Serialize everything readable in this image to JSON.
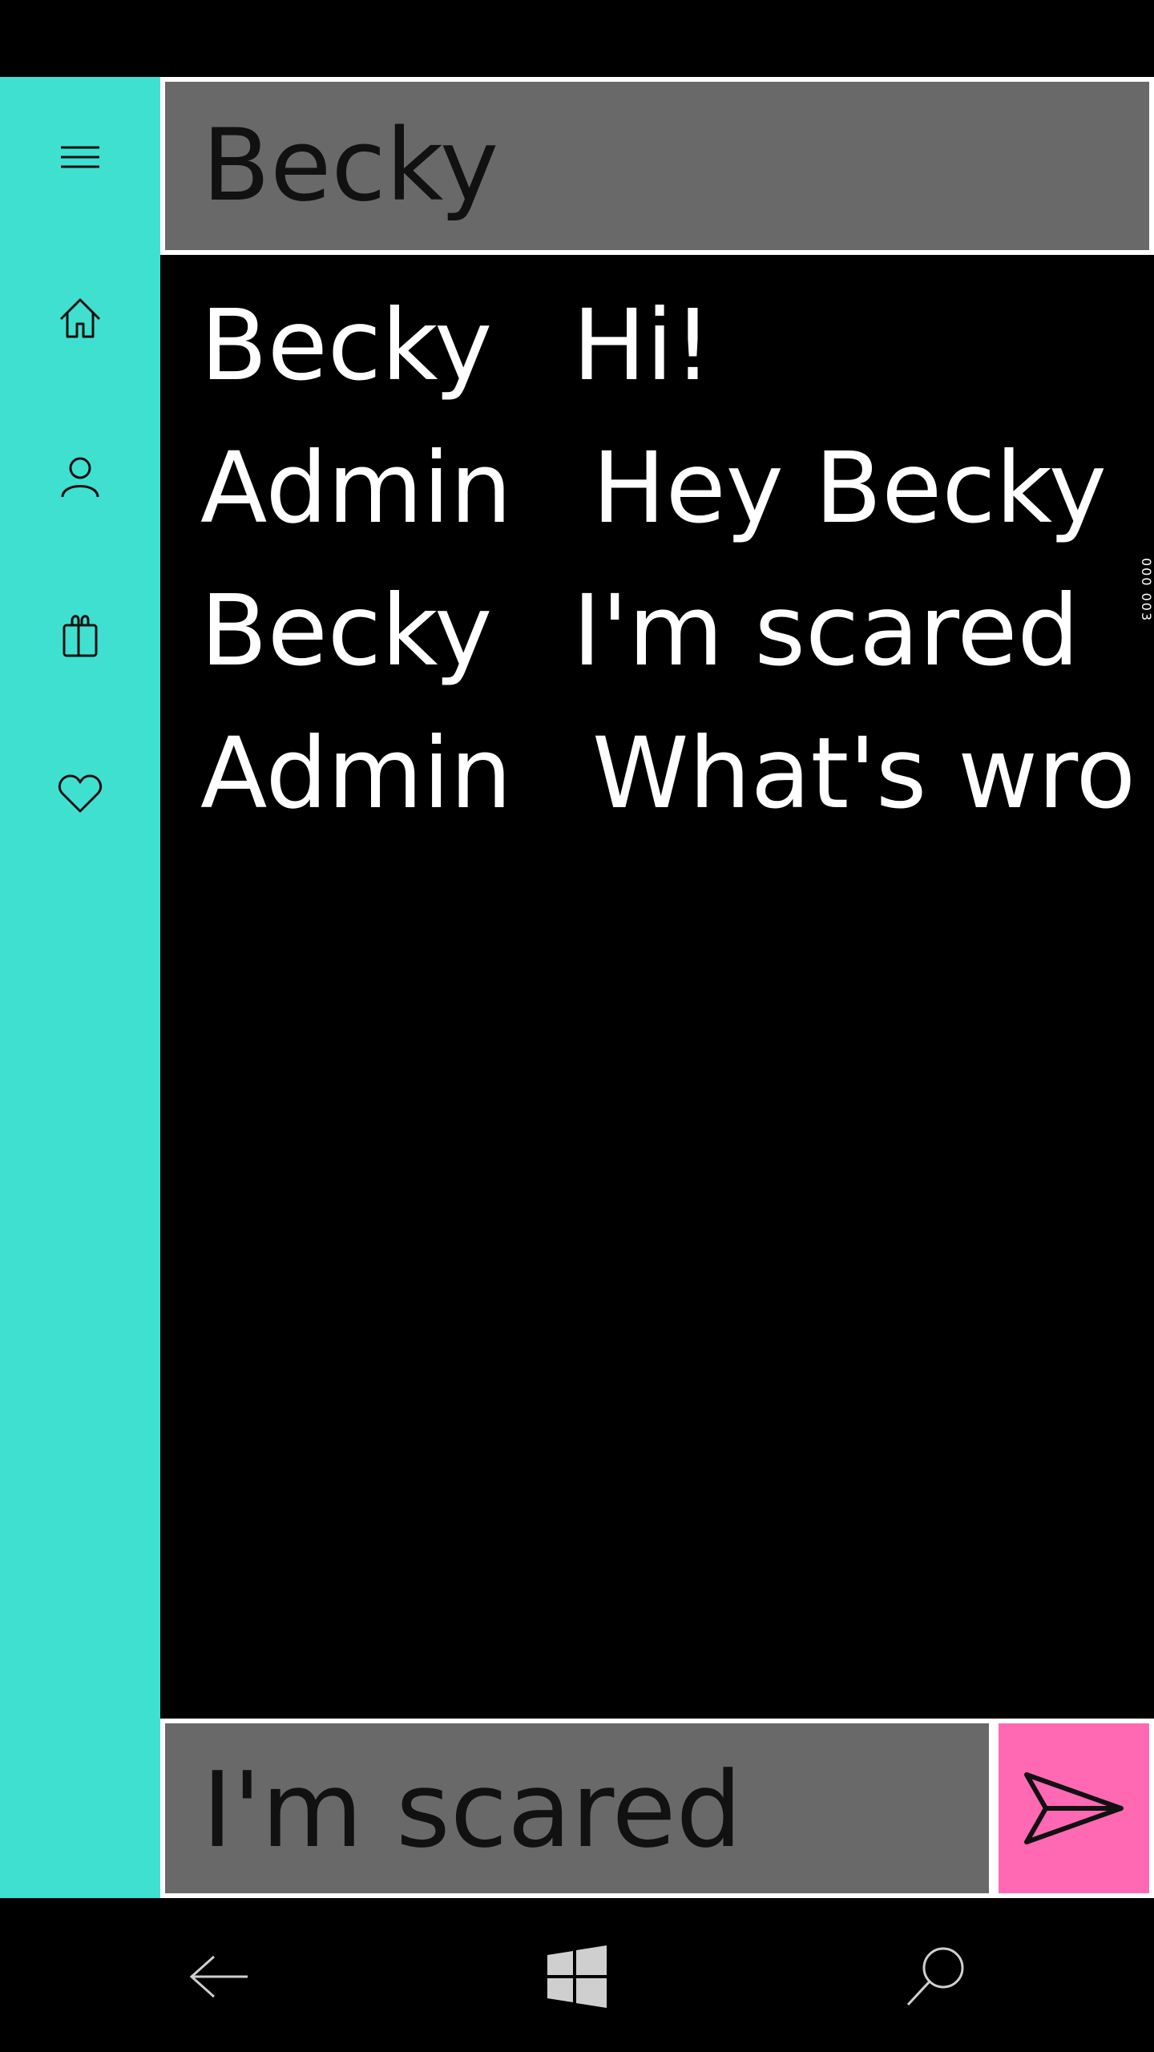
{
  "chat": {
    "title": "Becky",
    "messages": [
      {
        "sender": "Becky",
        "text": "Hi!"
      },
      {
        "sender": "Admin",
        "text": "Hey Becky"
      },
      {
        "sender": "Becky",
        "text": "I'm scared"
      },
      {
        "sender": "Admin",
        "text": "What's wro"
      }
    ],
    "scroll_indicator": "000 003"
  },
  "composer": {
    "value": "I'm scared"
  },
  "sidebar": {
    "icons": [
      "hamburger-menu-icon",
      "home-icon",
      "person-icon",
      "shopping-bag-icon",
      "heart-icon"
    ]
  },
  "navbar": {
    "icons": [
      "back-arrow-icon",
      "windows-logo-icon",
      "search-icon"
    ]
  },
  "colors": {
    "sidebar": "#40E0D0",
    "field": "#696969",
    "send": "#FF69B4",
    "background": "#000000"
  }
}
